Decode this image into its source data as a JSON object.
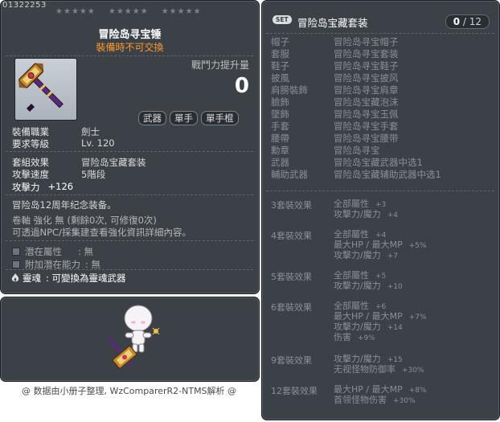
{
  "item": {
    "id": "01322253",
    "name": "冒险岛寻宝锤",
    "trade_note": "裝備時不可交換",
    "power_label": "戰鬥力提升量",
    "power_value": "0",
    "tags": [
      "武器",
      "單手",
      "單手棍"
    ],
    "stats": [
      {
        "key": "裝備職業",
        "value": "劍士"
      },
      {
        "key": "要求等級",
        "value": "Lv. 120"
      }
    ],
    "set_effect": {
      "key": "套組效果",
      "value": "冒险岛宝藏套装"
    },
    "attack_speed": {
      "key": "攻擊速度",
      "value": "5階段"
    },
    "attack": {
      "key": "攻擊力",
      "value": "+126"
    },
    "description": "冒险岛12周年纪念装备。",
    "scroll_line": "卷軸 強化 無 (剩餘0次, 可修復0次)",
    "npc_line": "可透過NPC/採集建查看強化資訊詳細內容。",
    "potential": {
      "key": "潛在屬性",
      "value": ": 無"
    },
    "bonus_potential": {
      "key": "附加潛在能力",
      "value": ": 無"
    },
    "soul": {
      "key": "靈魂",
      "value": ": 可變換為靈魂武器"
    }
  },
  "stars": {
    "groups": 3,
    "per_group": 5,
    "icon": "star-icon"
  },
  "credit": "@ 数据由小册子整理, WzComparerR2-NTMS解析 @",
  "set": {
    "badge": "SET",
    "name": "冒险岛宝藏套装",
    "count_current": "0",
    "count_sep": " / ",
    "count_total": "12",
    "parts": [
      {
        "slot": "帽子",
        "item": "冒险岛寻宝帽子"
      },
      {
        "slot": "套服",
        "item": "冒险岛寻宝套装"
      },
      {
        "slot": "鞋子",
        "item": "冒险岛寻宝鞋子"
      },
      {
        "slot": "披風",
        "item": "冒险岛寻宝披风"
      },
      {
        "slot": "肩膀裝飾",
        "item": "冒险岛寻宝肩章"
      },
      {
        "slot": "臉飾",
        "item": "冒险岛宝藏泡沫"
      },
      {
        "slot": "墜飾",
        "item": "冒险岛寻宝玉佩"
      },
      {
        "slot": "手套",
        "item": "冒险岛寻宝手套"
      },
      {
        "slot": "腰帶",
        "item": "冒险岛寻宝腰带"
      },
      {
        "slot": "勳章",
        "item": "冒险岛寻宝"
      },
      {
        "slot": "武器",
        "item": "冒险岛宝藏武器中选1"
      },
      {
        "slot": "輔助武器",
        "item": "冒险岛宝藏辅助武器中选1"
      }
    ],
    "effects": [
      {
        "title": "3套裝效果",
        "lines": [
          [
            "全部屬性",
            "+3"
          ],
          [
            "攻擊力/魔力",
            "+4"
          ]
        ]
      },
      {
        "title": "4套裝效果",
        "lines": [
          [
            "全部屬性",
            "+4"
          ],
          [
            "最大HP / 最大MP",
            "+5%"
          ],
          [
            "攻擊力/魔力",
            "+7"
          ]
        ]
      },
      {
        "title": "5套裝效果",
        "lines": [
          [
            "全部屬性",
            "+5"
          ],
          [
            "攻擊力/魔力",
            "+10"
          ]
        ]
      },
      {
        "title": "6套裝效果",
        "lines": [
          [
            "全部屬性",
            "+6"
          ],
          [
            "最大HP / 最大MP",
            "+7%"
          ],
          [
            "攻擊力/魔力",
            "+14"
          ],
          [
            "伤害",
            "+9%"
          ]
        ]
      },
      {
        "title": "9套裝效果",
        "lines": [
          [
            "攻擊力/魔力",
            "+15"
          ],
          [
            "无视怪物防御率",
            "+30%"
          ]
        ]
      },
      {
        "title": "12套裝效果",
        "lines": [
          [
            "最大HP / 最大MP",
            "+8%"
          ],
          [
            "首领怪物伤害",
            "+30%"
          ]
        ]
      }
    ]
  }
}
